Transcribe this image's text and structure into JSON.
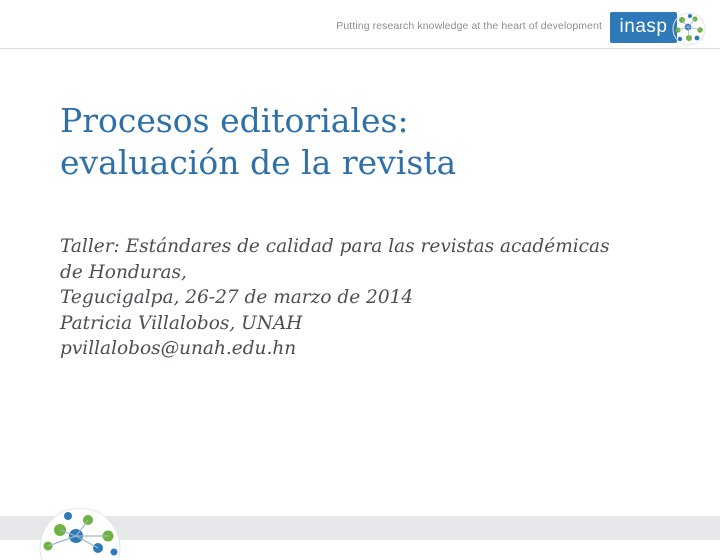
{
  "header": {
    "tagline": "Putting research knowledge at the heart of development",
    "logo_text": "inasp"
  },
  "slide": {
    "title_lines": [
      "Procesos editoriales:",
      "evaluación de la revista"
    ],
    "body_lines": [
      "Taller: Estándares de calidad para las revistas académicas",
      "de Honduras,",
      "Tegucigalpa, 26-27 de marzo de 2014",
      "Patricia Villalobos, UNAH",
      "pvillalobos@unah.edu.hn"
    ]
  },
  "colors": {
    "title": "#2f70a8",
    "body": "#4a4f55",
    "logo_bg": "#2e7ab8",
    "globe_green": "#6db33f",
    "globe_blue": "#2e7ab8"
  }
}
